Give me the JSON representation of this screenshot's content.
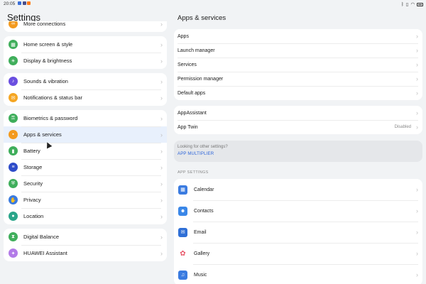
{
  "status": {
    "time": "20:05",
    "notif_colors": [
      "#3a6fd8",
      "#4a4f8c",
      "#ff7a1a"
    ]
  },
  "left": {
    "title": "Settings",
    "groups": [
      [
        {
          "label": "More connections",
          "icon": "link-icon",
          "color": "#f39a1e",
          "glyph": "∞"
        }
      ],
      [
        {
          "label": "Home screen & style",
          "icon": "home-screen-icon",
          "color": "#3fae5b",
          "glyph": "▦"
        },
        {
          "label": "Display & brightness",
          "icon": "display-icon",
          "color": "#3fae5b",
          "glyph": "☀"
        }
      ],
      [
        {
          "label": "Sounds & vibration",
          "icon": "sound-icon",
          "color": "#6a4fe0",
          "glyph": "♪"
        },
        {
          "label": "Notifications & status bar",
          "icon": "bell-icon",
          "color": "#f5a623",
          "glyph": "✉"
        }
      ],
      [
        {
          "label": "Biometrics & password",
          "icon": "key-icon",
          "color": "#3fae5b",
          "glyph": "⚿"
        },
        {
          "label": "Apps & services",
          "icon": "apps-icon",
          "color": "#f39a1e",
          "glyph": "▪",
          "active": true
        },
        {
          "label": "Battery",
          "icon": "battery-icon",
          "color": "#3fae5b",
          "glyph": "▮"
        },
        {
          "label": "Storage",
          "icon": "storage-icon",
          "color": "#2e4cc9",
          "glyph": "≡"
        },
        {
          "label": "Security",
          "icon": "shield-icon",
          "color": "#3fae5b",
          "glyph": "⛨"
        },
        {
          "label": "Privacy",
          "icon": "privacy-icon",
          "color": "#3a7be0",
          "glyph": "✋"
        },
        {
          "label": "Location",
          "icon": "location-pin-icon",
          "color": "#2aa58a",
          "glyph": "●"
        }
      ],
      [
        {
          "label": "Digital Balance",
          "icon": "hourglass-icon",
          "color": "#3fae5b",
          "glyph": "⧗"
        },
        {
          "label": "HUAWEI Assistant",
          "icon": "assistant-icon",
          "color": "#b37be8",
          "glyph": "✦"
        }
      ]
    ]
  },
  "right": {
    "title": "Apps & services",
    "group1": [
      "Apps",
      "Launch manager",
      "Services",
      "Permission manager",
      "Default apps"
    ],
    "group2": [
      {
        "label": "AppAssistant",
        "value": ""
      },
      {
        "label": "App Twin",
        "value": "Disabled"
      }
    ],
    "hint_question": "Looking for other settings?",
    "hint_link": "APP MULTIPLIER",
    "section_header": "APP SETTINGS",
    "apps": [
      {
        "label": "Calendar",
        "icon": "calendar-icon",
        "color": "#3a7be0",
        "glyph": "▦"
      },
      {
        "label": "Contacts",
        "icon": "contacts-icon",
        "color": "#3a87e8",
        "glyph": "☻"
      },
      {
        "label": "Email",
        "icon": "email-icon",
        "color": "#2f6fd6",
        "glyph": "✉"
      },
      {
        "label": "Gallery",
        "icon": "gallery-icon",
        "color": "#ffffff",
        "glyph": "✿"
      },
      {
        "label": "Music",
        "icon": "music-icon",
        "color": "#3a7be0",
        "glyph": "♫"
      }
    ]
  }
}
